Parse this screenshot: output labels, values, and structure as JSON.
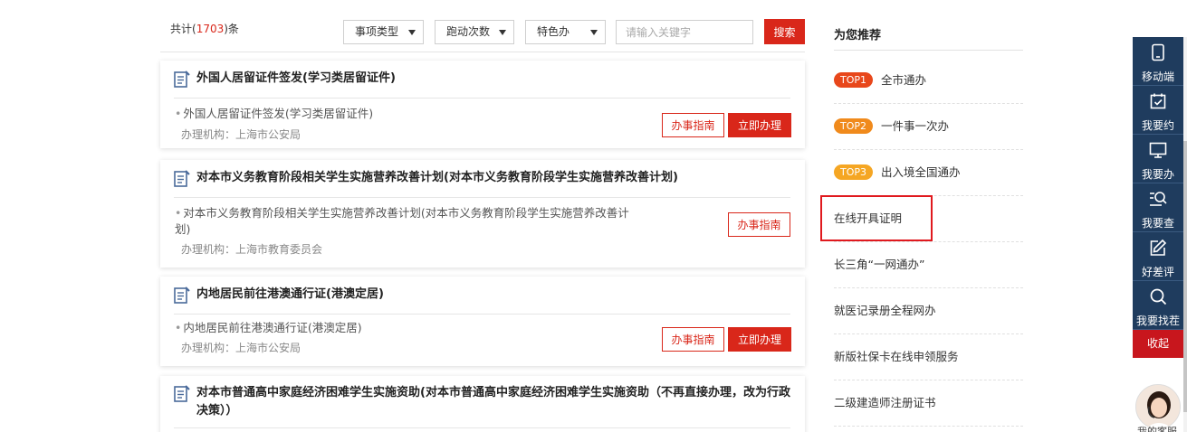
{
  "filter": {
    "count_prefix": "共计(",
    "count_value": "1703",
    "count_suffix": ")条",
    "selects": [
      "事项类型",
      "跑动次数",
      "特色办"
    ],
    "search_placeholder": "请输入关键字",
    "search_button": "搜索"
  },
  "results": [
    {
      "title": "外国人居留证件签发(学习类居留证件)",
      "item": "外国人居留证件签发(学习类居留证件)",
      "item_line2": "",
      "org": "办理机构：上海市公安局",
      "guide_label": "办事指南",
      "do_label": "立即办理"
    },
    {
      "title": "对本市义务教育阶段相关学生实施营养改善计划(对本市义务教育阶段学生实施营养改善计划)",
      "item": "对本市义务教育阶段相关学生实施营养改善计划(对本市义务教育阶段学生实施营养改善计",
      "item_line2": "划)",
      "org": "办理机构：上海市教育委员会",
      "guide_label": "办事指南",
      "do_label": ""
    },
    {
      "title": "内地居民前往港澳通行证(港澳定居)",
      "item": "内地居民前往港澳通行证(港澳定居)",
      "item_line2": "",
      "org": "办理机构：上海市公安局",
      "guide_label": "办事指南",
      "do_label": "立即办理"
    },
    {
      "title_line1": "对本市普通高中家庭经济困难学生实施资助(对本市普通高中家庭经济困难学生实施资助（不再直接办理，改为行政",
      "title_line2": "决策））"
    }
  ],
  "recommend": {
    "title": "为您推荐",
    "items": [
      {
        "badge": "TOP1",
        "badge_color": "#e8471b",
        "label": "全市通办"
      },
      {
        "badge": "TOP2",
        "badge_color": "#f08a1c",
        "label": "一件事一次办"
      },
      {
        "badge": "TOP3",
        "badge_color": "#f5a623",
        "label": "出入境全国通办"
      },
      {
        "badge": "",
        "label": "在线开具证明"
      },
      {
        "badge": "",
        "label": "长三角“一网通办”"
      },
      {
        "badge": "",
        "label": "就医记录册全程网办"
      },
      {
        "badge": "",
        "label": "新版社保卡在线申领服务"
      },
      {
        "badge": "",
        "label": "二级建造师注册证书"
      }
    ]
  },
  "float_bar": {
    "items": [
      {
        "icon": "tablet-icon",
        "label": "移动端"
      },
      {
        "icon": "calendar-check-icon",
        "label": "我要约"
      },
      {
        "icon": "monitor-icon",
        "label": "我要办"
      },
      {
        "icon": "search-list-icon",
        "label": "我要查"
      },
      {
        "icon": "edit-icon",
        "label": "好差评"
      },
      {
        "icon": "search-icon",
        "label": "我要找茬"
      }
    ],
    "collapse": "收起",
    "service_label": "我的客服"
  },
  "colors": {
    "accent": "#d9271a",
    "float_bar_bg": "#1f3c5e",
    "highlight_border": "#e0191e"
  }
}
